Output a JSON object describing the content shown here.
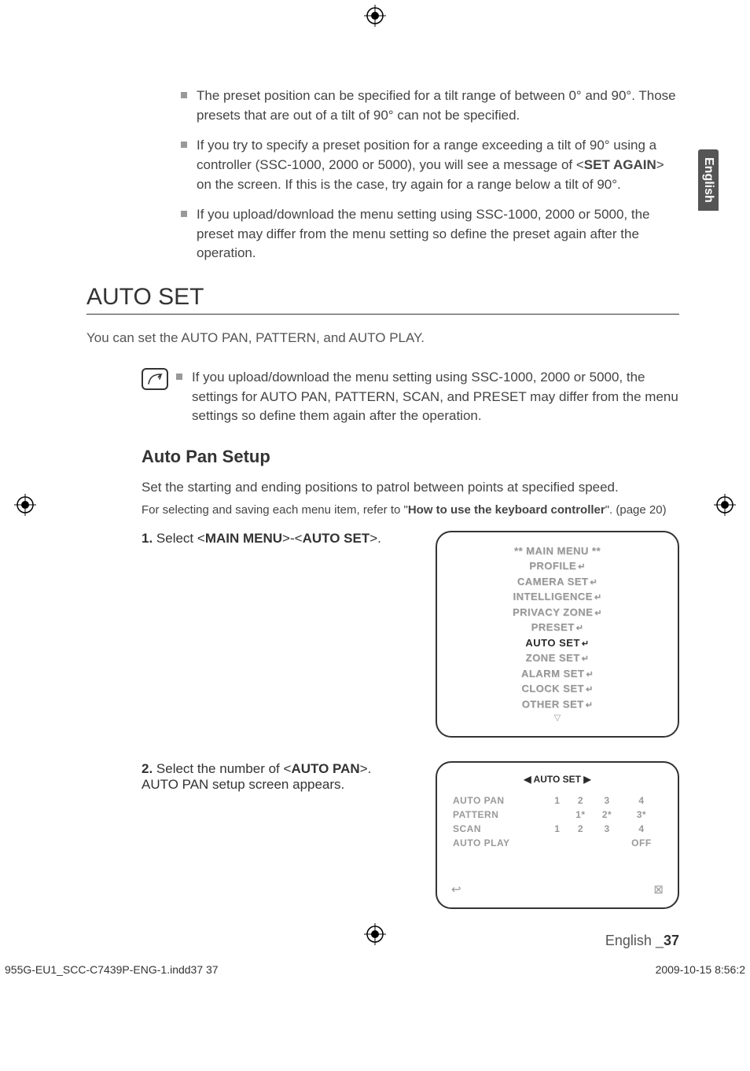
{
  "lang_tab": "English",
  "top_bullets": [
    "The preset position can be specified for a tilt range of between 0° and 90°. Those presets that are out of a tilt of 90° can not be specified.",
    "If you try to specify a preset position for a range exceeding a tilt of 90° using a controller (SSC-1000, 2000 or 5000), you will see a message of <__B__SET AGAIN__B__> on the screen. If this is the case, try again for a range below a tilt of 90°.",
    "If you upload/download the menu setting using SSC-1000, 2000 or 5000, the preset may differ from the menu setting so define the preset again after the operation."
  ],
  "section_title": "AUTO SET",
  "intro": "You can set the AUTO PAN, PATTERN, and AUTO PLAY.",
  "note_bullet": "If you upload/download the menu setting using SSC-1000, 2000 or 5000, the settings for AUTO PAN, PATTERN, SCAN, and PRESET may differ from the menu settings so define them again after the operation.",
  "sub_heading": "Auto Pan Setup",
  "sub_body": "Set the starting and ending positions to patrol between points at specified speed.",
  "sub_small_pre": "For selecting and saving each menu item, refer to \"",
  "sub_small_bold": "How to use the keyboard controller",
  "sub_small_post": "\". (page 20)",
  "step1_num": "1.",
  "step1_pre": " Select <",
  "step1_b1": "MAIN MENU",
  "step1_mid": ">-<",
  "step1_b2": "AUTO SET",
  "step1_post": ">.",
  "main_menu": {
    "title": "** MAIN MENU **",
    "items": [
      "PROFILE",
      "CAMERA SET",
      "INTELLIGENCE",
      "PRIVACY ZONE",
      "PRESET",
      "AUTO SET",
      "ZONE SET",
      "ALARM SET",
      "CLOCK SET",
      "OTHER SET"
    ],
    "active": "AUTO SET"
  },
  "step2_num": "2.",
  "step2_pre": " Select the number of <",
  "step2_b1": "AUTO PAN",
  "step2_post": ">.",
  "step2_line2": "AUTO PAN setup screen appears.",
  "auto_set_screen": {
    "header": "◀  AUTO SET  ▶",
    "rows": [
      {
        "label": "AUTO PAN",
        "c1": "1",
        "c2": "2",
        "c3": "3",
        "c4": "4"
      },
      {
        "label": "PATTERN",
        "c1": "",
        "c2": "1*",
        "c3": "2*",
        "c4": "3*"
      },
      {
        "label": "SCAN",
        "c1": "1",
        "c2": "2",
        "c3": "3",
        "c4": "4"
      },
      {
        "label": "AUTO PLAY",
        "c1": "",
        "c2": "",
        "c3": "",
        "c4": "OFF"
      }
    ],
    "back_icon": "↩",
    "close_icon": "⊠"
  },
  "footer_lang": "English _",
  "footer_page": "37",
  "print_left": "955G-EU1_SCC-C7439P-ENG-1.indd37   37",
  "print_right": "2009-10-15   8:56:2"
}
